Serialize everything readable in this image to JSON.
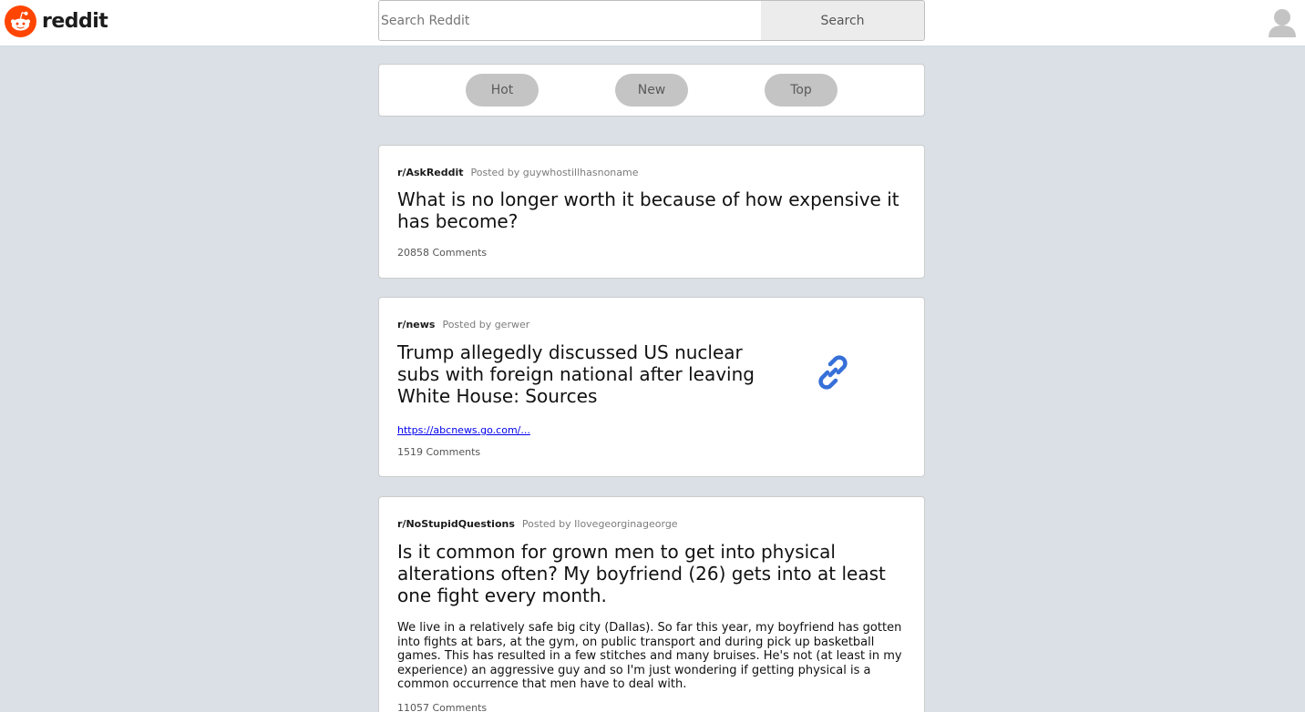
{
  "header": {
    "logo_text": "reddit",
    "logo_color": "#ff4500",
    "search_placeholder": "Search Reddit",
    "search_button": "Search"
  },
  "sort": {
    "options": [
      "Hot",
      "New",
      "Top"
    ]
  },
  "posts": [
    {
      "subreddit": "r/AskReddit",
      "posted_by": "Posted by guywhostillhasnoname",
      "title": "What is no longer worth it because of how expensive it has become?",
      "comments": "20858 Comments"
    },
    {
      "subreddit": "r/news",
      "posted_by": "Posted by gerwer",
      "title": "Trump allegedly discussed US nuclear subs with foreign national after leaving White House: Sources",
      "link": "https://abcnews.go.com/...",
      "thumb_icon": "link-icon",
      "comments": "1519 Comments"
    },
    {
      "subreddit": "r/NoStupidQuestions",
      "posted_by": "Posted by Ilovegeorginageorge",
      "title": "Is it common for grown men to get into physical alterations often? My boyfriend (26) gets into at least one fight every month.",
      "body": "We live in a relatively safe big city (Dallas). So far this year, my boyfriend has gotten into fights at bars, at the gym, on public transport and during pick up basketball games. This has resulted in a few stitches and many bruises. He's not (at least in my experience) an aggressive guy and so I'm just wondering if getting physical is a common occurrence that men have to deal with.",
      "comments": "11057 Comments"
    }
  ]
}
